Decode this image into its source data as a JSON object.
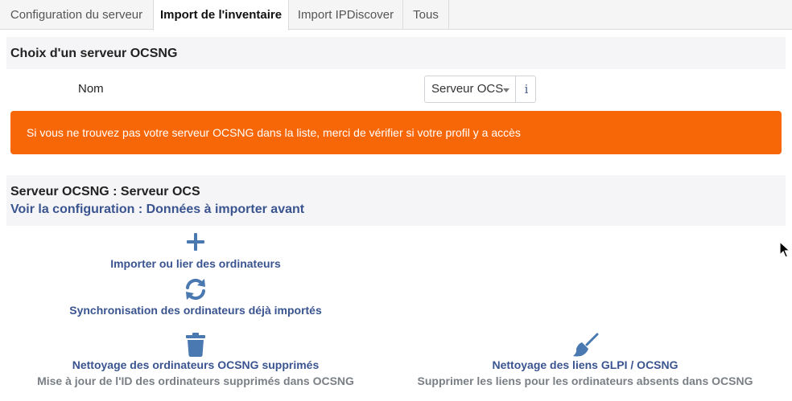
{
  "tabs": [
    {
      "label": "Configuration du serveur",
      "active": false
    },
    {
      "label": "Import de l'inventaire",
      "active": true
    },
    {
      "label": "Import IPDiscover",
      "active": false
    },
    {
      "label": "Tous",
      "active": false
    }
  ],
  "server_choice": {
    "title": "Choix d'un serveur OCSNG",
    "name_label": "Nom",
    "selected_server": "Serveur OCS",
    "info_icon": "info-icon"
  },
  "alert": {
    "text": "Si vous ne trouvez pas votre serveur OCSNG dans la liste, merci de vérifier si votre profil y a accès",
    "color": "#f76707"
  },
  "server_section": {
    "server_line": "Serveur OCSNG : Serveur OCS",
    "config_link": "Voir la configuration : Données à importer avant"
  },
  "actions": {
    "import": {
      "label": "Importer ou lier des ordinateurs",
      "icon": "plus-icon"
    },
    "sync": {
      "label": "Synchronisation des ordinateurs déjà importés",
      "icon": "sync-icon"
    },
    "clean_deleted": {
      "label": "Nettoyage des ordinateurs OCSNG supprimés",
      "sublabel": "Mise à jour de l'ID des ordinateurs supprimés dans OCSNG",
      "icon": "trash-icon"
    },
    "clean_links": {
      "label": "Nettoyage des liens GLPI / OCSNG",
      "sublabel": "Supprimer les liens pour les ordinateurs absents dans OCSNG",
      "icon": "broom-icon"
    }
  },
  "colors": {
    "link": "#3a5490",
    "icon": "#4a78b0",
    "muted": "#7a7f86"
  }
}
